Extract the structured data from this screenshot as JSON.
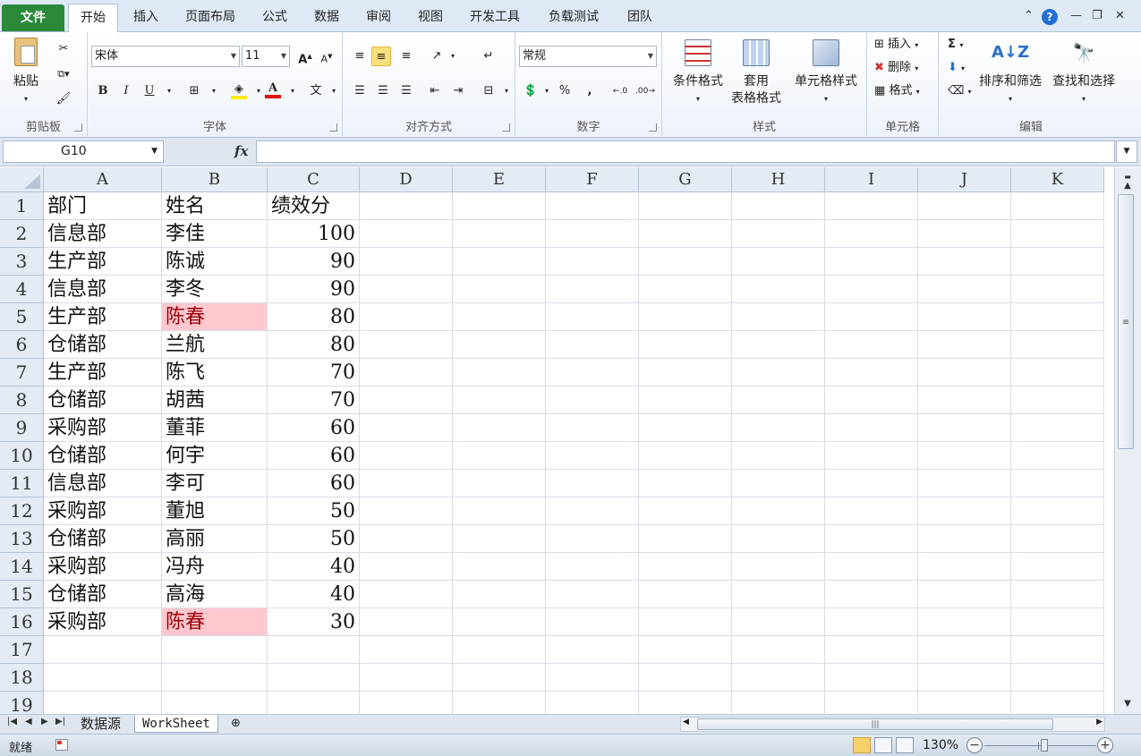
{
  "tabs": [
    "文件",
    "开始",
    "插入",
    "页面布局",
    "公式",
    "数据",
    "审阅",
    "视图",
    "开发工具",
    "负载测试",
    "团队"
  ],
  "ribbon": {
    "clipboard": {
      "paste": "粘贴",
      "label": "剪贴板"
    },
    "font": {
      "name": "宋体",
      "size": "11",
      "bold": "B",
      "italic": "I",
      "underline": "U",
      "label": "字体"
    },
    "alignment": {
      "label": "对齐方式"
    },
    "number": {
      "format": "常规",
      "percent": "%",
      "comma": ",",
      "label": "数字"
    },
    "styles": {
      "conditional": "条件格式",
      "table_line1": "套用",
      "table_line2": "表格格式",
      "cell_styles": "单元格样式",
      "label": "样式"
    },
    "cells": {
      "insert": "插入",
      "delete": "删除",
      "format": "格式",
      "label": "单元格"
    },
    "editing": {
      "sigma": "Σ",
      "sort": "排序和筛选",
      "find": "查找和选择",
      "label": "编辑"
    }
  },
  "formula_bar": {
    "name_box": "G10",
    "fx": "fx",
    "formula": ""
  },
  "grid": {
    "columns": [
      "A",
      "B",
      "C",
      "D",
      "E",
      "F",
      "G",
      "H",
      "I",
      "J",
      "K"
    ],
    "row_numbers": [
      "1",
      "2",
      "3",
      "4",
      "5",
      "6",
      "7",
      "8",
      "9",
      "10",
      "11",
      "12",
      "13",
      "14",
      "15",
      "16",
      "17",
      "18",
      "19"
    ],
    "rows": [
      {
        "a": "部门",
        "b": "姓名",
        "c": "绩效分",
        "dup": false
      },
      {
        "a": "信息部",
        "b": "李佳",
        "c": "100",
        "dup": false
      },
      {
        "a": "生产部",
        "b": "陈诚",
        "c": "90",
        "dup": false
      },
      {
        "a": "信息部",
        "b": "李冬",
        "c": "90",
        "dup": false
      },
      {
        "a": "生产部",
        "b": "陈春",
        "c": "80",
        "dup": true
      },
      {
        "a": "仓储部",
        "b": "兰航",
        "c": "80",
        "dup": false
      },
      {
        "a": "生产部",
        "b": "陈飞",
        "c": "70",
        "dup": false
      },
      {
        "a": "仓储部",
        "b": "胡茜",
        "c": "70",
        "dup": false
      },
      {
        "a": "采购部",
        "b": "董菲",
        "c": "60",
        "dup": false
      },
      {
        "a": "仓储部",
        "b": "何宇",
        "c": "60",
        "dup": false
      },
      {
        "a": "信息部",
        "b": "李可",
        "c": "60",
        "dup": false
      },
      {
        "a": "采购部",
        "b": "董旭",
        "c": "50",
        "dup": false
      },
      {
        "a": "仓储部",
        "b": "高丽",
        "c": "50",
        "dup": false
      },
      {
        "a": "采购部",
        "b": "冯舟",
        "c": "40",
        "dup": false
      },
      {
        "a": "仓储部",
        "b": "高海",
        "c": "40",
        "dup": false
      },
      {
        "a": "采购部",
        "b": "陈春",
        "c": "30",
        "dup": true
      }
    ]
  },
  "sheets": {
    "first": "数据源",
    "second": "WorkSheet"
  },
  "status": {
    "ready": "就绪",
    "zoom": "130%"
  },
  "colors": {
    "duplicate_fill": "#ffc7ce",
    "duplicate_text": "#9c0006",
    "file_tab": "#2a8a3a"
  }
}
